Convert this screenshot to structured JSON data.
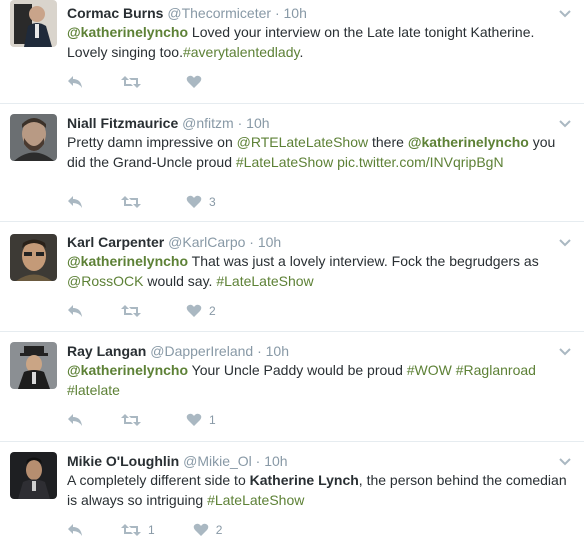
{
  "tweets": [
    {
      "name": "Cormac Burns",
      "handle": "@Thecormiceter",
      "time": "10h",
      "segments": [
        {
          "t": "@katherinelyncho",
          "k": "mention"
        },
        {
          "t": " Loved your interview on the Late late tonight Katherine. Lovely singing too.",
          "k": "text"
        },
        {
          "t": "#averytalentedlady",
          "k": "link"
        },
        {
          "t": ".",
          "k": "text"
        }
      ],
      "retweets": "",
      "likes": ""
    },
    {
      "name": "Niall Fitzmaurice",
      "handle": "@nfitzm",
      "time": "10h",
      "segments": [
        {
          "t": "Pretty damn impressive on ",
          "k": "text"
        },
        {
          "t": "@RTELateLateShow",
          "k": "link"
        },
        {
          "t": " there ",
          "k": "text"
        },
        {
          "t": "@katherinelyncho",
          "k": "mention"
        },
        {
          "t": " you did the Grand-Uncle proud ",
          "k": "text"
        },
        {
          "t": "#LateLateShow",
          "k": "link"
        },
        {
          "t": " ",
          "k": "text"
        },
        {
          "t": "pic.twitter.com/INVqripBgN",
          "k": "link"
        }
      ],
      "retweets": "",
      "likes": "3"
    },
    {
      "name": "Karl Carpenter",
      "handle": "@KarlCarpo",
      "time": "10h",
      "segments": [
        {
          "t": "@katherinelyncho",
          "k": "mention"
        },
        {
          "t": " That was just a lovely interview. Fock the begrudgers as ",
          "k": "text"
        },
        {
          "t": "@RossOCK",
          "k": "link"
        },
        {
          "t": " would say. ",
          "k": "text"
        },
        {
          "t": "#LateLateShow",
          "k": "link"
        }
      ],
      "retweets": "",
      "likes": "2"
    },
    {
      "name": "Ray Langan",
      "handle": "@DapperIreland",
      "time": "10h",
      "segments": [
        {
          "t": "@katherinelyncho",
          "k": "mention"
        },
        {
          "t": " Your Uncle Paddy would be proud ",
          "k": "text"
        },
        {
          "t": "#WOW",
          "k": "link"
        },
        {
          "t": " ",
          "k": "text"
        },
        {
          "t": "#Raglanroad",
          "k": "link"
        },
        {
          "t": " ",
          "k": "text"
        },
        {
          "t": "#latelate",
          "k": "link"
        }
      ],
      "retweets": "",
      "likes": "1"
    },
    {
      "name": "Mikie O'Loughlin",
      "handle": "@Mikie_Ol",
      "time": "10h",
      "segments": [
        {
          "t": "A completely different side to ",
          "k": "text"
        },
        {
          "t": "Katherine Lynch",
          "k": "bold"
        },
        {
          "t": ", the person behind the comedian is always so intriguing ",
          "k": "text"
        },
        {
          "t": "#LateLateShow",
          "k": "link"
        }
      ],
      "retweets": "1",
      "likes": "2"
    }
  ],
  "colors": {
    "link": "#5d8136",
    "muted": "#8899a6",
    "icon": "#aab8c2",
    "divider": "#e6ecf0"
  },
  "icons": {
    "reply": "reply-icon",
    "retweet": "retweet-icon",
    "like": "heart-icon",
    "more": "chevron-down-icon"
  }
}
